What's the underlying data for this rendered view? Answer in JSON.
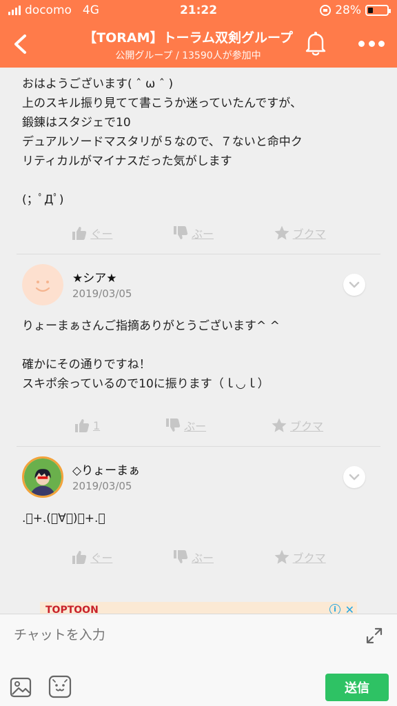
{
  "status_bar": {
    "carrier": "docomo",
    "network": "4G",
    "time": "21:22",
    "battery": "28%",
    "battery_level": 0.28
  },
  "header": {
    "title": "【TORAM】トーラム双剣グループ",
    "subtitle": "公開グループ / 13590人が参加中"
  },
  "post": {
    "text": "おはようございます( ˆ ω ˆ )\n上のスキル振り見てて書こうか迷っていたんですが、\n鍛錬はスタジェで10\nデュアルソードマスタリが５なので、７ないと命中ク\nリティカルがマイナスだった気がします\n\n(；ﾟДﾟ)",
    "actions": {
      "good": "ぐー",
      "boo": "ぶー",
      "bookmark": "ブクマ"
    }
  },
  "comments": [
    {
      "author": "★シア★",
      "date": "2019/03/05",
      "text": "りょーまぁさんご指摘ありがとうございます^ ^\n\n確かにその通りですね！\nスキポ余っているので10に振ります（ｌ◡ｌ）",
      "actions": {
        "good": "1",
        "boo": "ぶー",
        "bookmark": "ブクマ"
      }
    },
    {
      "author": "◇りょーまぁ",
      "date": "2019/03/05",
      "text": ".ﾟ+.(・∀・)ﾟ+.ﾟ",
      "actions": {
        "good": "ぐー",
        "boo": "ぶー",
        "bookmark": "ブクマ"
      }
    }
  ],
  "ad": {
    "logo": "TOPTOON"
  },
  "input": {
    "placeholder": "チャットを入力",
    "send_label": "送信"
  },
  "colors": {
    "accent": "#ff7b4a",
    "send": "#2ec264"
  }
}
